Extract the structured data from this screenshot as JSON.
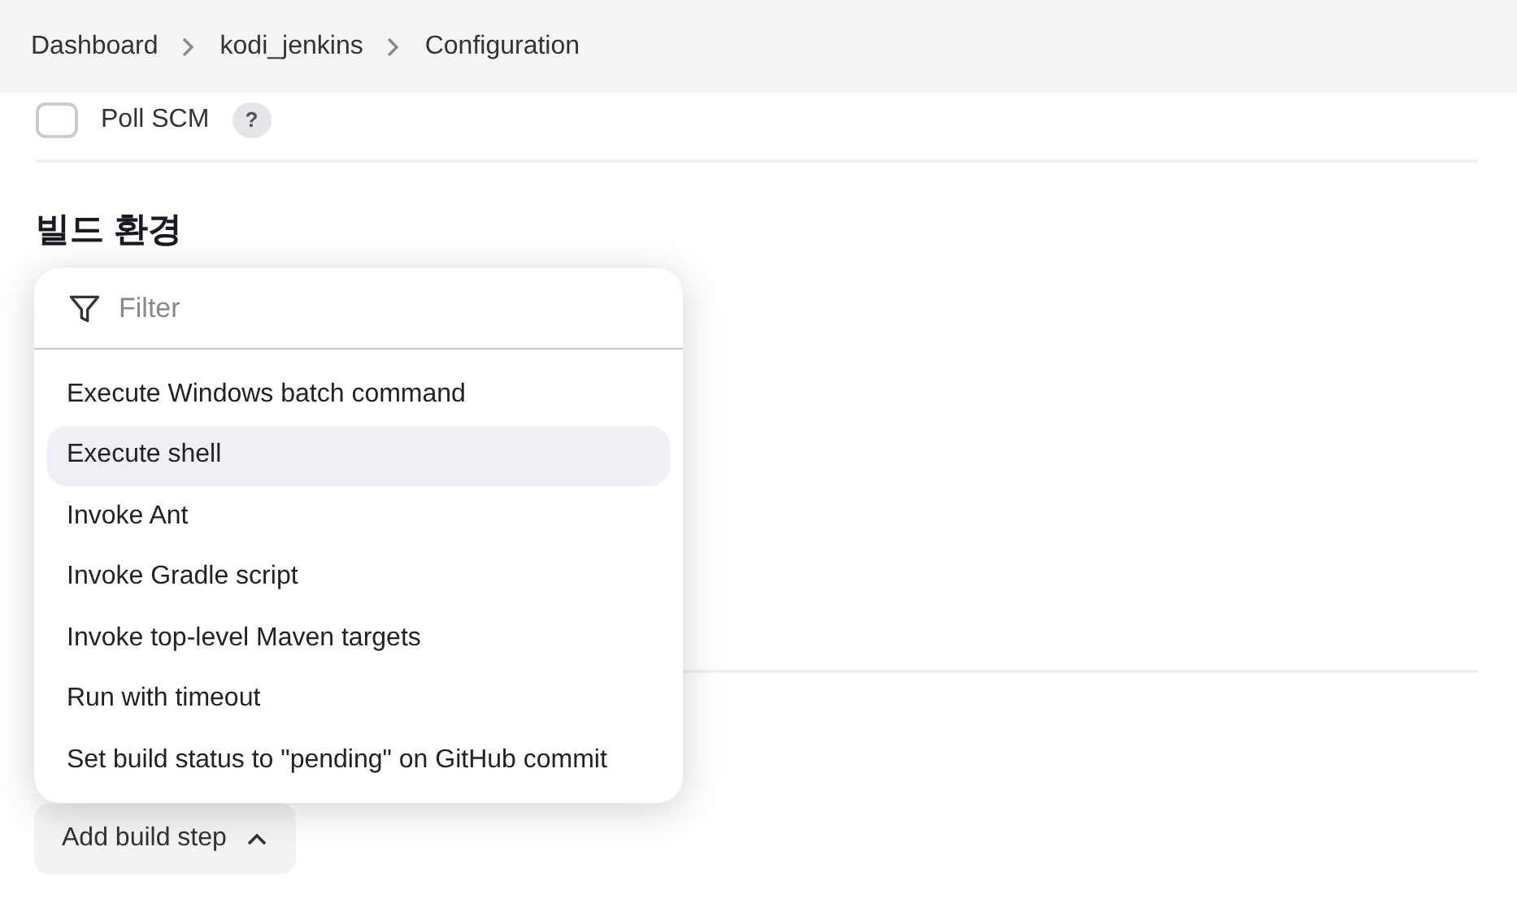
{
  "breadcrumbs": [
    {
      "label": "Dashboard"
    },
    {
      "label": "kodi_jenkins"
    },
    {
      "label": "Configuration"
    }
  ],
  "poll_scm": {
    "label": "Poll SCM",
    "checked": false,
    "help": "?"
  },
  "section_title": "빌드 환경",
  "menu": {
    "filter_placeholder": "Filter",
    "items": [
      {
        "label": "Execute Windows batch command",
        "selected": false
      },
      {
        "label": "Execute shell",
        "selected": true
      },
      {
        "label": "Invoke Ant",
        "selected": false
      },
      {
        "label": "Invoke Gradle script",
        "selected": false
      },
      {
        "label": "Invoke top-level Maven targets",
        "selected": false
      },
      {
        "label": "Run with timeout",
        "selected": false
      },
      {
        "label": "Set build status to \"pending\" on GitHub commit",
        "selected": false
      }
    ]
  },
  "add_button": {
    "label": "Add build step",
    "expanded": true
  }
}
